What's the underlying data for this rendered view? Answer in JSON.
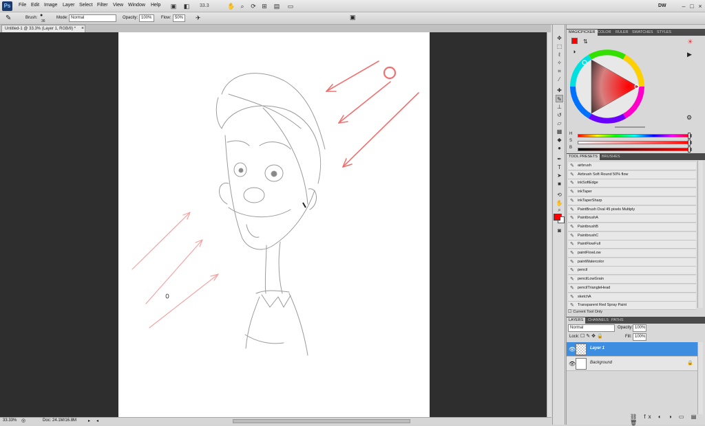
{
  "app": {
    "logo": "Ps",
    "menu": [
      "File",
      "Edit",
      "Image",
      "Layer",
      "Select",
      "Filter",
      "View",
      "Window",
      "Help"
    ],
    "zoom_field": "33.3",
    "workspace": "DW"
  },
  "options_bar": {
    "brush_label": "Brush:",
    "brush_size": "36",
    "mode_label": "Mode:",
    "mode_value": "Normal",
    "opacity_label": "Opacity:",
    "opacity_value": "100%",
    "flow_label": "Flow:",
    "flow_value": "50%"
  },
  "document": {
    "tab_title": "Untitled-1 @ 33.3% (Layer 1, RGB/8) *",
    "tab_close": "×",
    "zoom_status": "33.33%",
    "doc_status": "Doc: 24.1M/16.8M"
  },
  "panels": {
    "color_tabs": [
      "MagicPicker",
      "Color",
      "Ruler",
      "Swatches",
      "Styles"
    ],
    "sliders": [
      {
        "label": "H",
        "value": 0.99
      },
      {
        "label": "S",
        "value": 0.99
      },
      {
        "label": "B",
        "value": 0.99
      }
    ],
    "preset_tabs": [
      "Tool Presets",
      "Brushes"
    ],
    "presets": [
      "airbrush",
      "Airbrush Soft Round 50% flow",
      "inkSoftEdge",
      "inkTaper",
      "inkTaperSharp",
      "PaintBrush Oval 45 pixels Multiply",
      "PaintbrushA",
      "PaintbrushB",
      "PaintbrushC",
      "PaintFlowFull",
      "paintFlowLow",
      "paintWatercolor",
      "pencil",
      "pencilLowGrain",
      "pencilTriangleHead",
      "sketchA",
      "Transparent Red Spray Paint"
    ],
    "current_tool_only": "Current Tool Only",
    "layer_tabs": [
      "Layers",
      "Channels",
      "Paths"
    ],
    "blend_mode": "Normal",
    "opacity_label": "Opacity:",
    "opacity_value": "100%",
    "lock_label": "Lock:",
    "fill_label": "Fill:",
    "fill_value": "100%",
    "layers": [
      {
        "name": "Layer 1",
        "selected": true
      },
      {
        "name": "Background",
        "selected": false
      }
    ]
  },
  "colors": {
    "foreground": "#ff0000",
    "background": "#ffffff",
    "selection": "#3d8ee0"
  }
}
